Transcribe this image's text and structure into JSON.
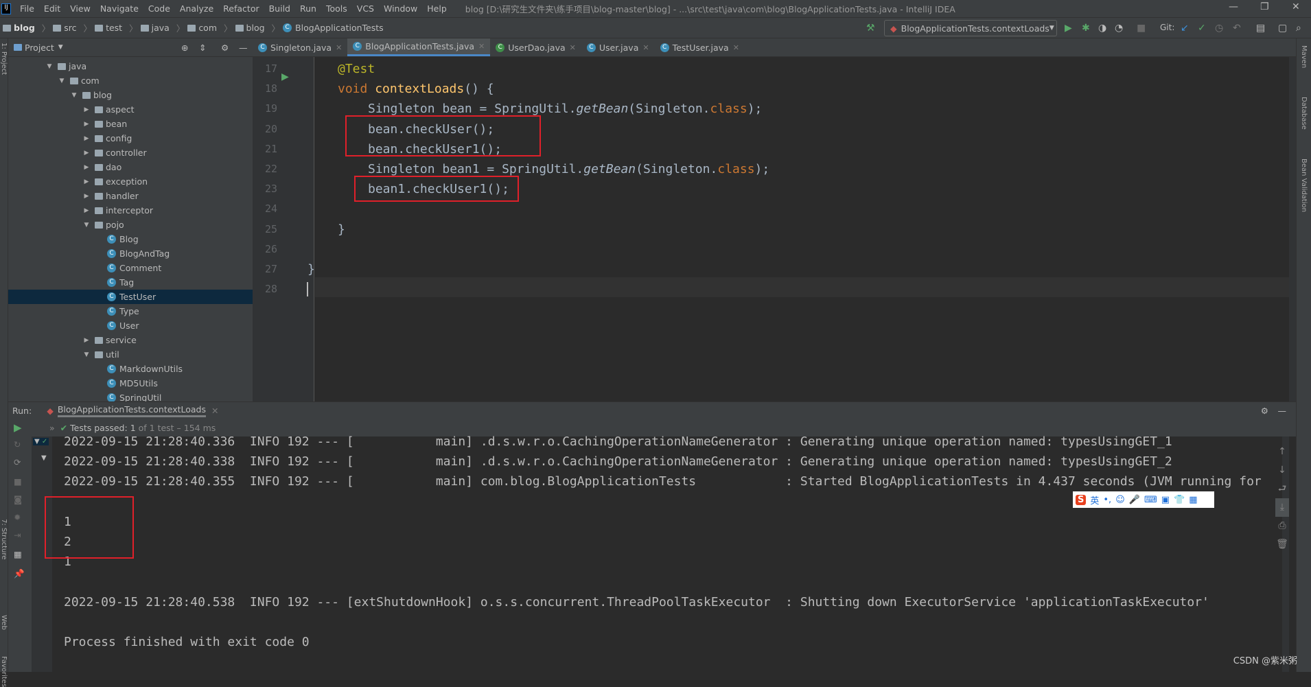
{
  "window": {
    "title": "blog [D:\\研究生文件夹\\练手项目\\blog-master\\blog] - ...\\src\\test\\java\\com\\blog\\BlogApplicationTests.java - IntelliJ IDEA"
  },
  "menu": [
    "File",
    "Edit",
    "View",
    "Navigate",
    "Code",
    "Analyze",
    "Refactor",
    "Build",
    "Run",
    "Tools",
    "VCS",
    "Window",
    "Help"
  ],
  "breadcrumb": [
    "blog",
    "src",
    "test",
    "java",
    "com",
    "blog",
    "BlogApplicationTests"
  ],
  "run_config": "BlogApplicationTests.contextLoads",
  "git_label": "Git:",
  "project_panel": {
    "title": "Project"
  },
  "tabs": [
    {
      "label": "Singleton.java",
      "active": false
    },
    {
      "label": "BlogApplicationTests.java",
      "active": true
    },
    {
      "label": "UserDao.java",
      "active": false
    },
    {
      "label": "User.java",
      "active": false
    },
    {
      "label": "TestUser.java",
      "active": false
    }
  ],
  "tree": [
    {
      "label": "java",
      "depth": 0,
      "type": "folder",
      "expanded": true
    },
    {
      "label": "com",
      "depth": 1,
      "type": "folder",
      "expanded": true
    },
    {
      "label": "blog",
      "depth": 2,
      "type": "folder",
      "expanded": true
    },
    {
      "label": "aspect",
      "depth": 3,
      "type": "folder",
      "expanded": false
    },
    {
      "label": "bean",
      "depth": 3,
      "type": "folder",
      "expanded": false
    },
    {
      "label": "config",
      "depth": 3,
      "type": "folder",
      "expanded": false
    },
    {
      "label": "controller",
      "depth": 3,
      "type": "folder",
      "expanded": false
    },
    {
      "label": "dao",
      "depth": 3,
      "type": "folder",
      "expanded": false
    },
    {
      "label": "exception",
      "depth": 3,
      "type": "folder",
      "expanded": false
    },
    {
      "label": "handler",
      "depth": 3,
      "type": "folder",
      "expanded": false
    },
    {
      "label": "interceptor",
      "depth": 3,
      "type": "folder",
      "expanded": false
    },
    {
      "label": "pojo",
      "depth": 3,
      "type": "folder",
      "expanded": true
    },
    {
      "label": "Blog",
      "depth": 4,
      "type": "class"
    },
    {
      "label": "BlogAndTag",
      "depth": 4,
      "type": "class"
    },
    {
      "label": "Comment",
      "depth": 4,
      "type": "class"
    },
    {
      "label": "Tag",
      "depth": 4,
      "type": "class"
    },
    {
      "label": "TestUser",
      "depth": 4,
      "type": "class",
      "selected": true
    },
    {
      "label": "Type",
      "depth": 4,
      "type": "class"
    },
    {
      "label": "User",
      "depth": 4,
      "type": "class"
    },
    {
      "label": "service",
      "depth": 3,
      "type": "folder",
      "expanded": false
    },
    {
      "label": "util",
      "depth": 3,
      "type": "folder",
      "expanded": true
    },
    {
      "label": "MarkdownUtils",
      "depth": 4,
      "type": "class"
    },
    {
      "label": "MD5Utils",
      "depth": 4,
      "type": "class"
    },
    {
      "label": "SpringUtil",
      "depth": 4,
      "type": "class"
    }
  ],
  "code": [
    {
      "n": "17",
      "indent": 0,
      "tokens": [
        [
          "an",
          "@Test"
        ]
      ]
    },
    {
      "n": "18",
      "indent": 0,
      "tokens": [
        [
          "kw",
          "void "
        ],
        [
          "fn",
          "contextLoads"
        ],
        [
          "",
          "() {"
        ]
      ]
    },
    {
      "n": "19",
      "indent": 1,
      "tokens": [
        [
          "",
          "Singleton bean = SpringUtil."
        ],
        [
          "it",
          "getBean"
        ],
        [
          "",
          "(Singleton."
        ],
        [
          "kw",
          "class"
        ],
        [
          "",
          ");"
        ]
      ]
    },
    {
      "n": "20",
      "indent": 1,
      "tokens": [
        [
          "",
          "bean.checkUser();"
        ]
      ]
    },
    {
      "n": "21",
      "indent": 1,
      "tokens": [
        [
          "",
          "bean.checkUser1();"
        ]
      ]
    },
    {
      "n": "22",
      "indent": 1,
      "tokens": [
        [
          "",
          "Singleton bean1 = SpringUtil."
        ],
        [
          "it",
          "getBean"
        ],
        [
          "",
          "(Singleton."
        ],
        [
          "kw",
          "class"
        ],
        [
          "",
          ");"
        ]
      ]
    },
    {
      "n": "23",
      "indent": 1,
      "tokens": [
        [
          "",
          "bean1.checkUser1();"
        ]
      ]
    },
    {
      "n": "24",
      "indent": 0,
      "tokens": []
    },
    {
      "n": "25",
      "indent": 0,
      "tokens": [
        [
          "",
          "}"
        ]
      ]
    },
    {
      "n": "26",
      "indent": 0,
      "tokens": []
    },
    {
      "n": "27",
      "indent": -1,
      "tokens": [
        [
          "",
          "}"
        ]
      ]
    },
    {
      "n": "28",
      "indent": -1,
      "tokens": []
    }
  ],
  "run": {
    "label": "Run:",
    "tab": "BlogApplicationTests.contextLoads",
    "status_prefix": "Tests passed:",
    "status_count": "1",
    "status_rest": "of 1 test – 154 ms"
  },
  "console": [
    "2022-09-15 21:28:40.336  INFO 192 --- [           main] .d.s.w.r.o.CachingOperationNameGenerator : Generating unique operation named: typesUsingGET_1",
    "2022-09-15 21:28:40.338  INFO 192 --- [           main] .d.s.w.r.o.CachingOperationNameGenerator : Generating unique operation named: typesUsingGET_2",
    "2022-09-15 21:28:40.355  INFO 192 --- [           main] com.blog.BlogApplicationTests            : Started BlogApplicationTests in 4.437 seconds (JVM running for",
    "",
    "1",
    "2",
    "1",
    "",
    "2022-09-15 21:28:40.538  INFO 192 --- [extShutdownHook] o.s.s.concurrent.ThreadPoolTaskExecutor  : Shutting down ExecutorService 'applicationTaskExecutor'",
    "",
    "Process finished with exit code 0"
  ],
  "side_tools": {
    "left": [
      "1: Project",
      "7: Structure",
      "Web",
      "2: Favorites"
    ],
    "right": [
      "Maven",
      "Database",
      "Bean Validation"
    ]
  },
  "ime": {
    "label": "英"
  },
  "watermark": "CSDN @紫米粥",
  "colors": {
    "highlight_box": "#e0202a",
    "accent": "#4a88c7",
    "selection": "#0d293e"
  }
}
